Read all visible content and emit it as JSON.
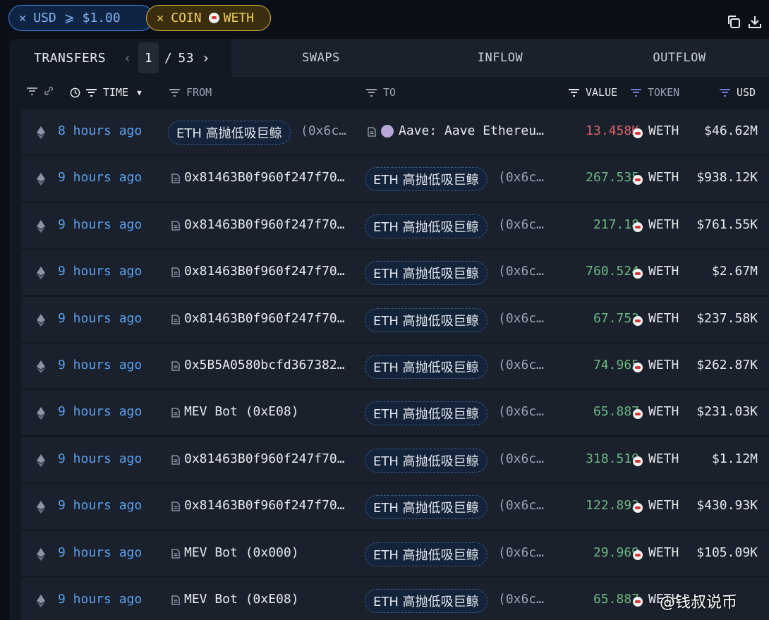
{
  "filters": {
    "usd_chip": {
      "close": "✕",
      "label": "USD ⩾ $1.00"
    },
    "coin_chip": {
      "close": "✕",
      "prefix": "COIN",
      "token": "WETH"
    }
  },
  "toolbar": {
    "copy_icon": "copy-icon",
    "download_icon": "download-icon"
  },
  "tabs": {
    "transfers": "TRANSFERS",
    "pager": {
      "current": "1",
      "separator": "/",
      "total": "53"
    },
    "swaps": "SWAPS",
    "inflow": "INFLOW",
    "outflow": "OUTFLOW"
  },
  "columns": {
    "time": "TIME",
    "from": "FROM",
    "to": "TO",
    "value": "VALUE",
    "token": "TOKEN",
    "usd": "USD"
  },
  "colors": {
    "inflow": "#6ab87f",
    "outflow": "#d9616a",
    "time_link": "#5aa0ee"
  },
  "rows": [
    {
      "time": "8 hours ago",
      "from_kind": "entity",
      "from": "ETH 高抛低吸巨鲸",
      "from_suffix": "(0x6c…",
      "to_kind": "entity-contract",
      "to": "Aave: Aave Ethereu…",
      "value": "13.458K",
      "direction": "out",
      "token": "WETH",
      "usd": "$46.62M"
    },
    {
      "time": "9 hours ago",
      "from_kind": "address",
      "from": "0x81463B0f960f247f70…",
      "to_kind": "entity",
      "to": "ETH 高抛低吸巨鲸",
      "to_suffix": "(0x6c…",
      "value": "267.535",
      "direction": "in",
      "token": "WETH",
      "usd": "$938.12K"
    },
    {
      "time": "9 hours ago",
      "from_kind": "address",
      "from": "0x81463B0f960f247f70…",
      "to_kind": "entity",
      "to": "ETH 高抛低吸巨鲸",
      "to_suffix": "(0x6c…",
      "value": "217.18",
      "direction": "in",
      "token": "WETH",
      "usd": "$761.55K"
    },
    {
      "time": "9 hours ago",
      "from_kind": "address",
      "from": "0x81463B0f960f247f70…",
      "to_kind": "entity",
      "to": "ETH 高抛低吸巨鲸",
      "to_suffix": "(0x6c…",
      "value": "760.524",
      "direction": "in",
      "token": "WETH",
      "usd": "$2.67M"
    },
    {
      "time": "9 hours ago",
      "from_kind": "address",
      "from": "0x81463B0f960f247f70…",
      "to_kind": "entity",
      "to": "ETH 高抛低吸巨鲸",
      "to_suffix": "(0x6c…",
      "value": "67.752",
      "direction": "in",
      "token": "WETH",
      "usd": "$237.58K"
    },
    {
      "time": "9 hours ago",
      "from_kind": "address",
      "from": "0x5B5A0580bcfd367382…",
      "to_kind": "entity",
      "to": "ETH 高抛低吸巨鲸",
      "to_suffix": "(0x6c…",
      "value": "74.965",
      "direction": "in",
      "token": "WETH",
      "usd": "$262.87K"
    },
    {
      "time": "9 hours ago",
      "from_kind": "address",
      "from": "MEV Bot (0xE08)",
      "to_kind": "entity",
      "to": "ETH 高抛低吸巨鲸",
      "to_suffix": "(0x6c…",
      "value": "65.887",
      "direction": "in",
      "token": "WETH",
      "usd": "$231.03K"
    },
    {
      "time": "9 hours ago",
      "from_kind": "address",
      "from": "0x81463B0f960f247f70…",
      "to_kind": "entity",
      "to": "ETH 高抛低吸巨鲸",
      "to_suffix": "(0x6c…",
      "value": "318.519",
      "direction": "in",
      "token": "WETH",
      "usd": "$1.12M"
    },
    {
      "time": "9 hours ago",
      "from_kind": "address",
      "from": "0x81463B0f960f247f70…",
      "to_kind": "entity",
      "to": "ETH 高抛低吸巨鲸",
      "to_suffix": "(0x6c…",
      "value": "122.893",
      "direction": "in",
      "token": "WETH",
      "usd": "$430.93K"
    },
    {
      "time": "9 hours ago",
      "from_kind": "address",
      "from": "MEV Bot (0x000)",
      "to_kind": "entity",
      "to": "ETH 高抛低吸巨鲸",
      "to_suffix": "(0x6c…",
      "value": "29.969",
      "direction": "in",
      "token": "WETH",
      "usd": "$105.09K"
    },
    {
      "time": "9 hours ago",
      "from_kind": "address",
      "from": "MEV Bot (0xE08)",
      "to_kind": "entity",
      "to": "ETH 高抛低吸巨鲸",
      "to_suffix": "(0x6c…",
      "value": "65.887",
      "direction": "in",
      "token": "WETH",
      "usd": ""
    }
  ],
  "watermark": "@钱叔说币"
}
